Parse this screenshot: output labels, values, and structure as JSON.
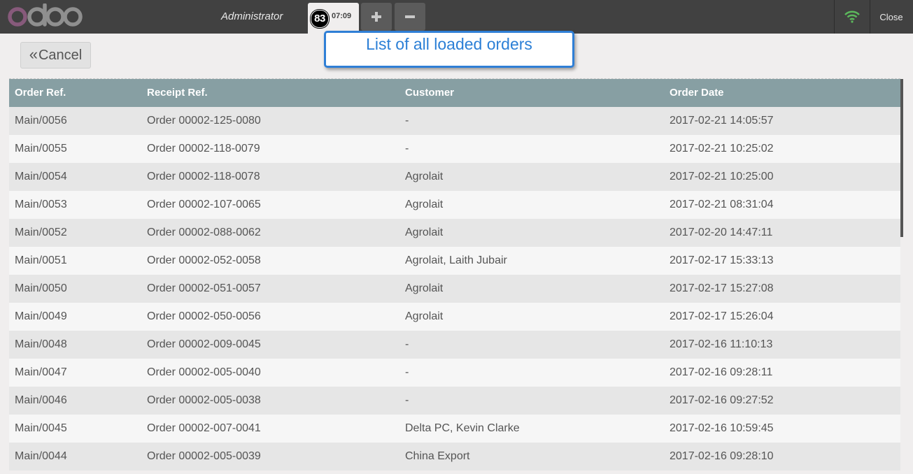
{
  "header": {
    "user": "Administrator",
    "order_tab": {
      "sequence": "83",
      "time": "07:09"
    },
    "add_order_icon": "plus-icon",
    "remove_order_icon": "minus-icon",
    "wifi_icon": "wifi-icon",
    "close_label": "Close",
    "colors": {
      "bar": "#414141",
      "wifi": "#5cb85c"
    }
  },
  "logo": {
    "text": "odoo"
  },
  "cancel_label": "Cancel",
  "callout_text": "List of all loaded orders",
  "table": {
    "columns": [
      "Order Ref.",
      "Receipt Ref.",
      "Customer",
      "Order Date"
    ],
    "rows": [
      [
        "Main/0056",
        "Order 00002-125-0080",
        "-",
        "2017-02-21 14:05:57"
      ],
      [
        "Main/0055",
        "Order 00002-118-0079",
        "-",
        "2017-02-21 10:25:02"
      ],
      [
        "Main/0054",
        "Order 00002-118-0078",
        "Agrolait",
        "2017-02-21 10:25:00"
      ],
      [
        "Main/0053",
        "Order 00002-107-0065",
        "Agrolait",
        "2017-02-21 08:31:04"
      ],
      [
        "Main/0052",
        "Order 00002-088-0062",
        "Agrolait",
        "2017-02-20 14:47:11"
      ],
      [
        "Main/0051",
        "Order 00002-052-0058",
        "Agrolait, Laith Jubair",
        "2017-02-17 15:33:13"
      ],
      [
        "Main/0050",
        "Order 00002-051-0057",
        "Agrolait",
        "2017-02-17 15:27:08"
      ],
      [
        "Main/0049",
        "Order 00002-050-0056",
        "Agrolait",
        "2017-02-17 15:26:04"
      ],
      [
        "Main/0048",
        "Order 00002-009-0045",
        "-",
        "2017-02-16 11:10:13"
      ],
      [
        "Main/0047",
        "Order 00002-005-0040",
        "-",
        "2017-02-16 09:28:11"
      ],
      [
        "Main/0046",
        "Order 00002-005-0038",
        "-",
        "2017-02-16 09:27:52"
      ],
      [
        "Main/0045",
        "Order 00002-007-0041",
        "Delta PC, Kevin Clarke",
        "2017-02-16 10:59:45"
      ],
      [
        "Main/0044",
        "Order 00002-005-0039",
        "China Export",
        "2017-02-16 09:28:10"
      ]
    ]
  }
}
